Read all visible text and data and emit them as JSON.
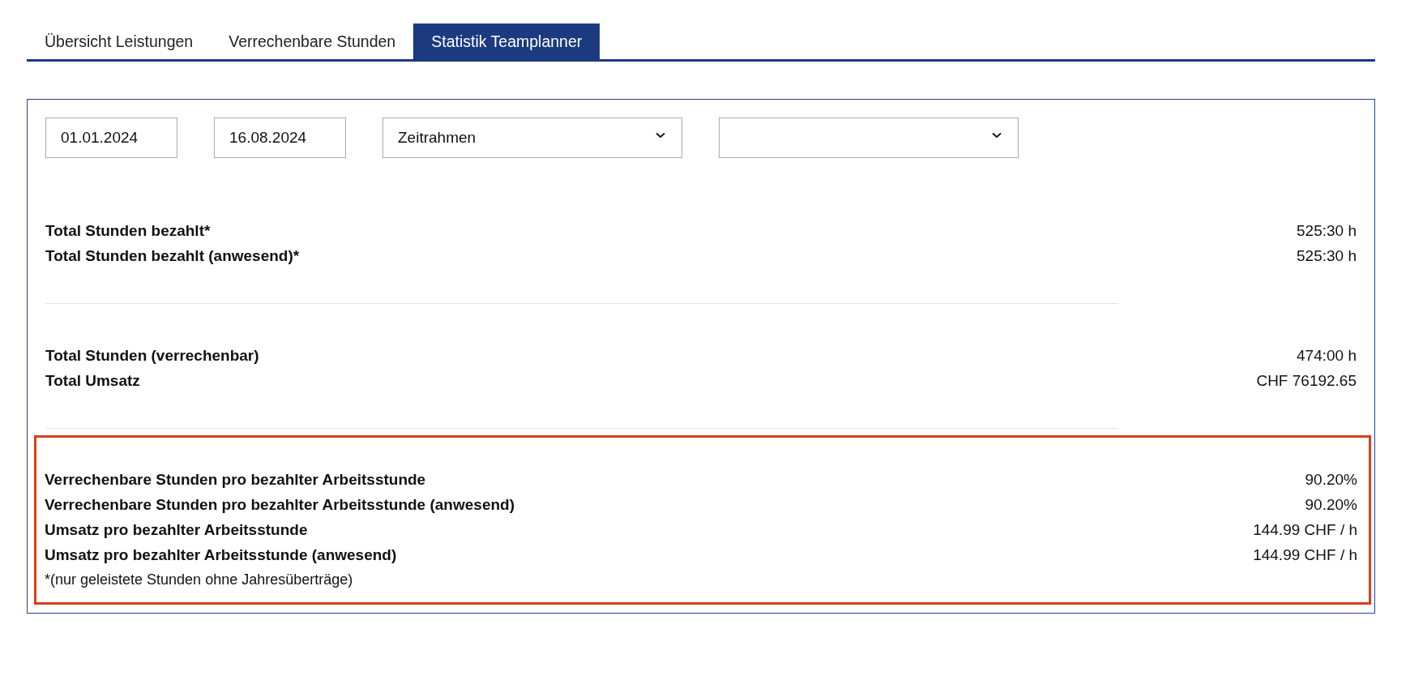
{
  "tabs": [
    {
      "label": "Übersicht Leistungen",
      "selected": false
    },
    {
      "label": "Verrechenbare Stunden",
      "selected": false
    },
    {
      "label": "Statistik Teamplanner",
      "selected": true
    }
  ],
  "filters": [
    {
      "kind": "date",
      "value": "01.01.2024"
    },
    {
      "kind": "date",
      "value": "16.08.2024"
    },
    {
      "kind": "select",
      "value": "Zeitrahmen"
    },
    {
      "kind": "select"
    }
  ],
  "groups": [
    {
      "highlighted": false,
      "rows": [
        {
          "label": "Total Stunden bezahlt*",
          "value": "525:30 h"
        },
        {
          "label": "Total Stunden bezahlt (anwesend)*",
          "value": "525:30 h"
        }
      ]
    },
    {
      "highlighted": false,
      "rows": [
        {
          "label": "Total Stunden (verrechenbar)",
          "value": "474:00 h"
        },
        {
          "label": "Total Umsatz",
          "value": "CHF 76192.65"
        }
      ]
    },
    {
      "highlighted": true,
      "rows": [
        {
          "label": "Verrechenbare Stunden pro bezahlter Arbeitsstunde",
          "value": "90.20%"
        },
        {
          "label": "Verrechenbare Stunden pro bezahlter Arbeitsstunde (anwesend)",
          "value": "90.20%"
        },
        {
          "label": "Umsatz pro bezahlter Arbeitsstunde",
          "value": "144.99 CHF / h"
        },
        {
          "label": "Umsatz pro bezahlter Arbeitsstunde (anwesend)",
          "value": "144.99 CHF / h"
        }
      ],
      "note": "*(nur geleistete Stunden ohne Jahresüberträge)"
    }
  ]
}
